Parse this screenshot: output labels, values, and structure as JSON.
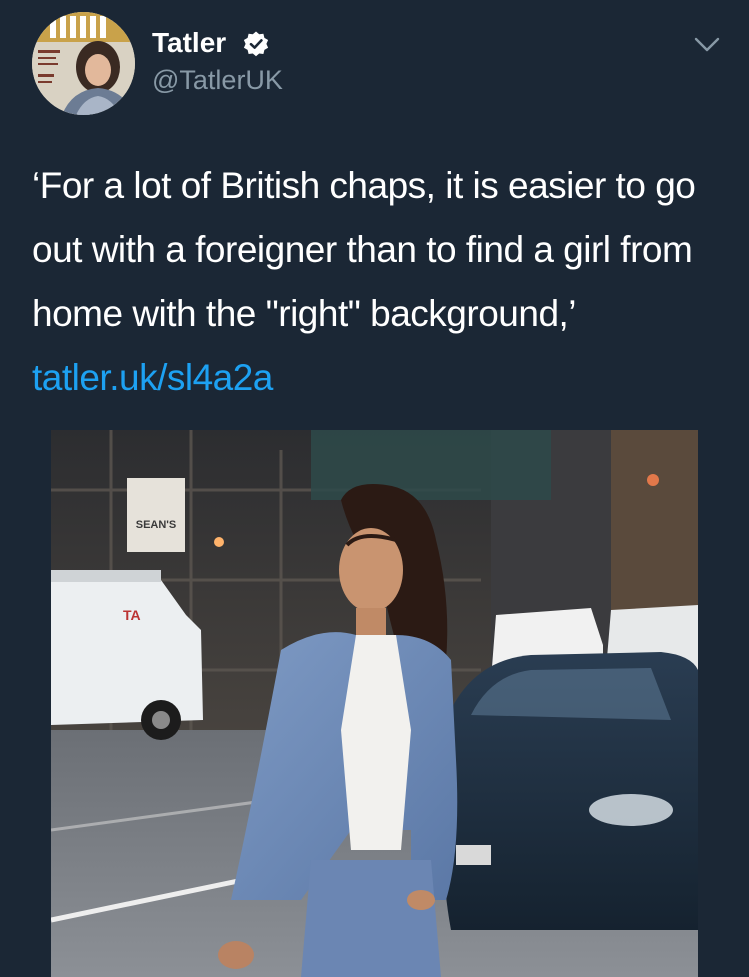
{
  "account": {
    "display_name": "Tatler",
    "handle": "@TatlerUK",
    "verified": true,
    "avatar_icon": "magazine-cover-avatar"
  },
  "tweet": {
    "text": "‘For a lot of British chaps, it is easier to go out with a foreigner than to find a girl from home with the \"right\" background,’ ",
    "link_text": "tatler.uk/sl4a2a",
    "link_color": "#1da1f2"
  },
  "media": {
    "description_icon": "street-photo",
    "signs": {
      "seans": "SEAN'S",
      "van": "TA"
    }
  },
  "colors": {
    "background": "#1b2735",
    "secondary_text": "#8899a6",
    "accent": "#1da1f2"
  },
  "icons": [
    "verified-badge-icon",
    "chevron-down-icon"
  ]
}
